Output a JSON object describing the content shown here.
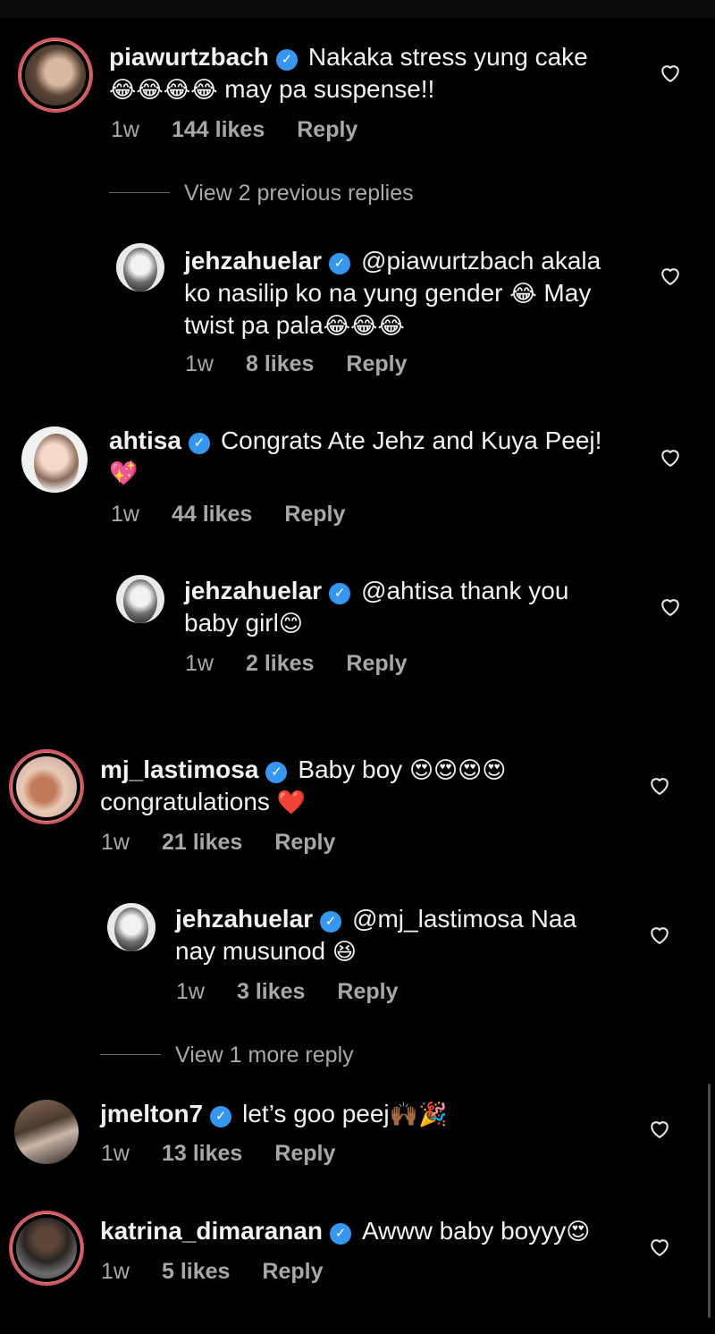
{
  "comments": [
    {
      "user": "piawurtzbach",
      "text_line1": "Nakaka stress yung cake",
      "emoji1": "😂😂😂😂",
      "text_line2": " may pa suspense!!",
      "time": "1w",
      "likes": "144 likes",
      "reply": "Reply"
    },
    {
      "view_replies": "View 2 previous replies",
      "user": "jehzahuelar",
      "text_line1": "@piawurtzbach akala",
      "text_line2a": "ko nasilip ko na yung gender ",
      "emoji2": "😂",
      "text_line2b": " May",
      "text_line3": "twist pa pala",
      "emoji3": "😂😂😂",
      "time": "1w",
      "likes": "8 likes",
      "reply": "Reply"
    },
    {
      "user": "ahtisa",
      "text_line1": "Congrats Ate Jehz and Kuya Peej!",
      "emoji2": "💖",
      "time": "1w",
      "likes": "44 likes",
      "reply": "Reply"
    },
    {
      "user": "jehzahuelar",
      "text_line1": "@ahtisa thank you",
      "text_line2": "baby girl",
      "emoji2": "😊",
      "time": "1w",
      "likes": "2 likes",
      "reply": "Reply"
    },
    {
      "user": "mj_lastimosa",
      "text_line1": "Baby boy ",
      "emoji1": "😍😍😍😍",
      "text_line2": "congratulations ",
      "emoji2": "❤️",
      "time": "1w",
      "likes": "21 likes",
      "reply": "Reply"
    },
    {
      "user": "jehzahuelar",
      "text_line1": "@mj_lastimosa Naa",
      "text_line2": "nay musunod ",
      "emoji2": "😆",
      "time": "1w",
      "likes": "3 likes",
      "reply": "Reply",
      "view_replies": "View 1 more reply"
    },
    {
      "user": "jmelton7",
      "text_line1": "let’s goo peej",
      "emoji1": "🙌🏾🎉",
      "time": "1w",
      "likes": "13 likes",
      "reply": "Reply"
    },
    {
      "user": "katrina_dimaranan",
      "text_line1": "Awww baby boyyy",
      "emoji1": "😍",
      "time": "1w",
      "likes": "5 likes",
      "reply": "Reply"
    }
  ],
  "colors": {
    "background": "#000000",
    "text": "#f2f2f2",
    "meta": "#a8a8a8",
    "verified": "#3797f0",
    "story_ring": "#d4546d"
  },
  "icons": {
    "verified": "verified-badge-icon",
    "like": "heart-outline-icon"
  }
}
